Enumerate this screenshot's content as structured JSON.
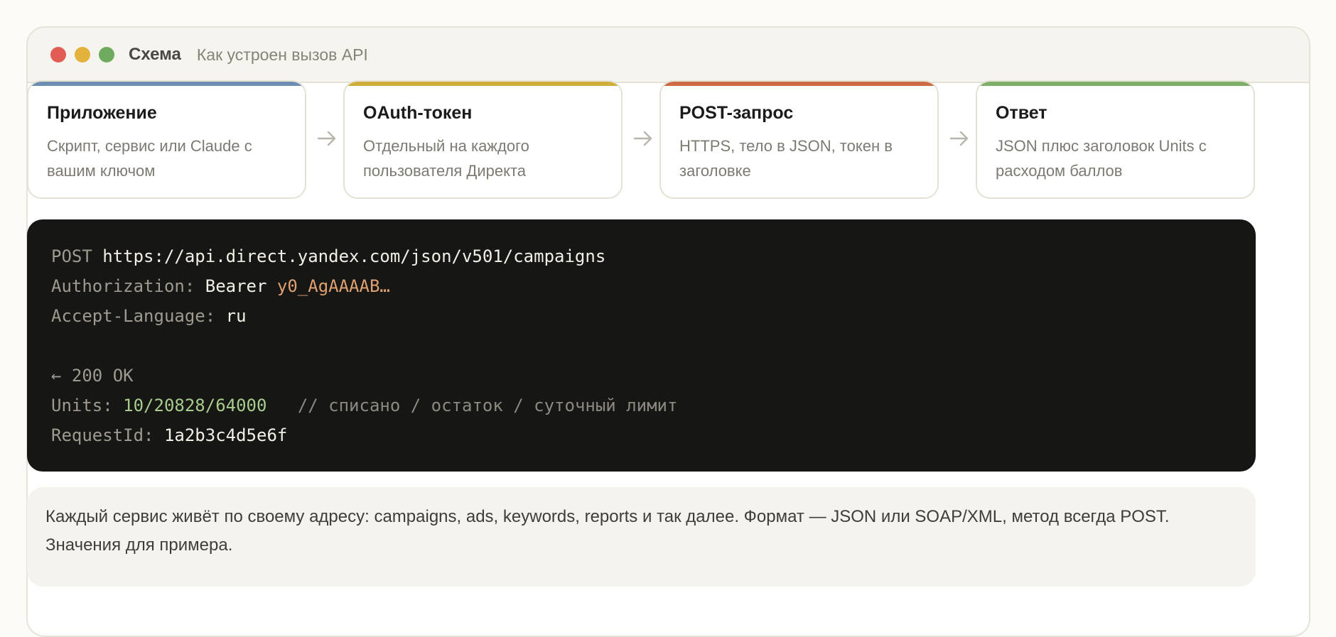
{
  "window": {
    "title": "Схема",
    "subtitle": "Как устроен вызов API",
    "dots": [
      "#e05c54",
      "#e3b23c",
      "#6fab5f"
    ]
  },
  "steps": [
    {
      "title": "Приложение",
      "desc_1": "Скрипт, сервис или Claude с",
      "desc_2": "вашим ключом",
      "accent": "#6d8db3"
    },
    {
      "title": "OAuth-токен",
      "desc_1": "Отдельный на каждого",
      "desc_2": "пользователя Директа",
      "accent": "#cfae3a"
    },
    {
      "title": "POST-запрос",
      "desc_1": "HTTPS, тело в JSON, токен в",
      "desc_2": "заголовке",
      "accent": "#cc6a45"
    },
    {
      "title": "Ответ",
      "desc_1": "JSON плюс заголовок Units с",
      "desc_2": "расходом баллов",
      "accent": "#7fae68"
    }
  ],
  "arrow_icon": "arrow-right-icon",
  "code": {
    "method": "POST",
    "url": "https://api.direct.yandex.com/json/v501/campaigns",
    "auth_key": "Authorization:",
    "auth_scheme": "Bearer",
    "auth_token": "y0_AgAAAAB…",
    "lang_key": "Accept-Language:",
    "lang_value": "ru",
    "status": "← 200 OK",
    "units_key": "Units:",
    "units_value": "10/20828/64000",
    "units_comment": "// списано / остаток / суточный лимит",
    "reqid_key": "RequestId:",
    "reqid_value": "1a2b3c4d5e6f"
  },
  "note": {
    "line_1": "Каждый сервис живёт по своему адресу: campaigns, ads, keywords, reports и так далее. Формат — JSON или SOAP/XML, метод всегда POST.",
    "line_2": "Значения для примера."
  }
}
